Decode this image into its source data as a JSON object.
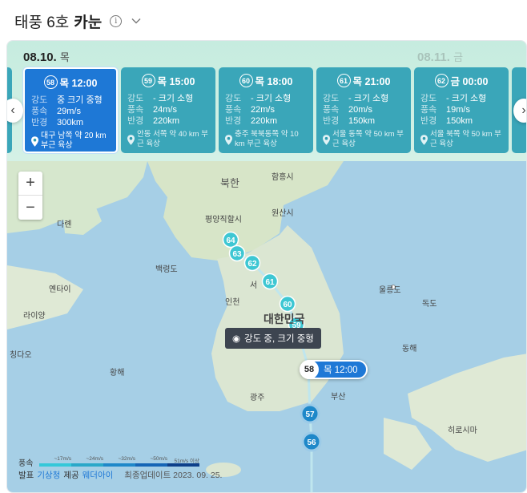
{
  "header": {
    "title_prefix": "태풍 6호",
    "title_name": "카눈",
    "info_icon": "info-icon",
    "toggle_icon": "chevron-down-icon"
  },
  "timeline": {
    "date_current": "08.10.",
    "day_current": "목",
    "date_next": "08.11.",
    "day_next": "금",
    "cards": [
      {
        "num": "58",
        "time": "목 12:00",
        "intensity_label": "강도",
        "intensity": "중 크기 중형",
        "wind_label": "풍속",
        "wind": "29m/s",
        "radius_label": "반경",
        "radius": "300km",
        "loc": "대구 남쪽 약 20 km 부근 육상",
        "active": true
      },
      {
        "num": "59",
        "time": "목 15:00",
        "intensity_label": "강도",
        "intensity": "- 크기 소형",
        "wind_label": "풍속",
        "wind": "24m/s",
        "radius_label": "반경",
        "radius": "220km",
        "loc": "안동 서쪽 약 40 km 부근 육상"
      },
      {
        "num": "60",
        "time": "목 18:00",
        "intensity_label": "강도",
        "intensity": "- 크기 소형",
        "wind_label": "풍속",
        "wind": "22m/s",
        "radius_label": "반경",
        "radius": "220km",
        "loc": "충주 북북동쪽 약 10 km 부근 육상"
      },
      {
        "num": "61",
        "time": "목 21:00",
        "intensity_label": "강도",
        "intensity": "- 크기 소형",
        "wind_label": "풍속",
        "wind": "20m/s",
        "radius_label": "반경",
        "radius": "150km",
        "loc": "서울 동쪽 약 50 km 부근 육상"
      },
      {
        "num": "62",
        "time": "금 00:00",
        "intensity_label": "강도",
        "intensity": "- 크기 소형",
        "wind_label": "풍속",
        "wind": "19m/s",
        "radius_label": "반경",
        "radius": "150km",
        "loc": "서울 북쪽 약 50 km 부근 육상"
      }
    ]
  },
  "map": {
    "labels": {
      "north": "북한",
      "pyongyang": "평양직할시",
      "hamheung": "함흥시",
      "wonsan": "원산시",
      "dalian": "다롄",
      "yantai": "옌타이",
      "laiyang": "라이양",
      "qingdao": "칭다오",
      "baengnyeong": "백령도",
      "incheon": "인천",
      "seoul": "서",
      "korea": "대한민국",
      "ulleung": "울릉도",
      "dokdo": "독도",
      "yellow_sea": "황해",
      "east_sea": "동해",
      "gwangju": "광주",
      "busan": "부산",
      "hiroshima": "히로시마"
    },
    "track_points": [
      "64",
      "63",
      "62",
      "61",
      "60",
      "59",
      "57",
      "56"
    ],
    "tooltip": "강도 중, 크기 중형",
    "current_marker": {
      "num": "58",
      "time": "목 12:00"
    }
  },
  "legend": {
    "title": "풍속",
    "ticks": [
      "~17m/s",
      "~24m/s",
      "~32m/s",
      "~50m/s",
      "51m/s 이상"
    ],
    "colors": [
      "#34c8d9",
      "#2aa8c9",
      "#1e88c9",
      "#1565b6",
      "#0d3f8a"
    ]
  },
  "footer": {
    "pub_label": "발표",
    "source": "기상청",
    "provide": "제공",
    "provider": "웨더아이",
    "updated": "최종업데이트 2023. 09. 25."
  }
}
